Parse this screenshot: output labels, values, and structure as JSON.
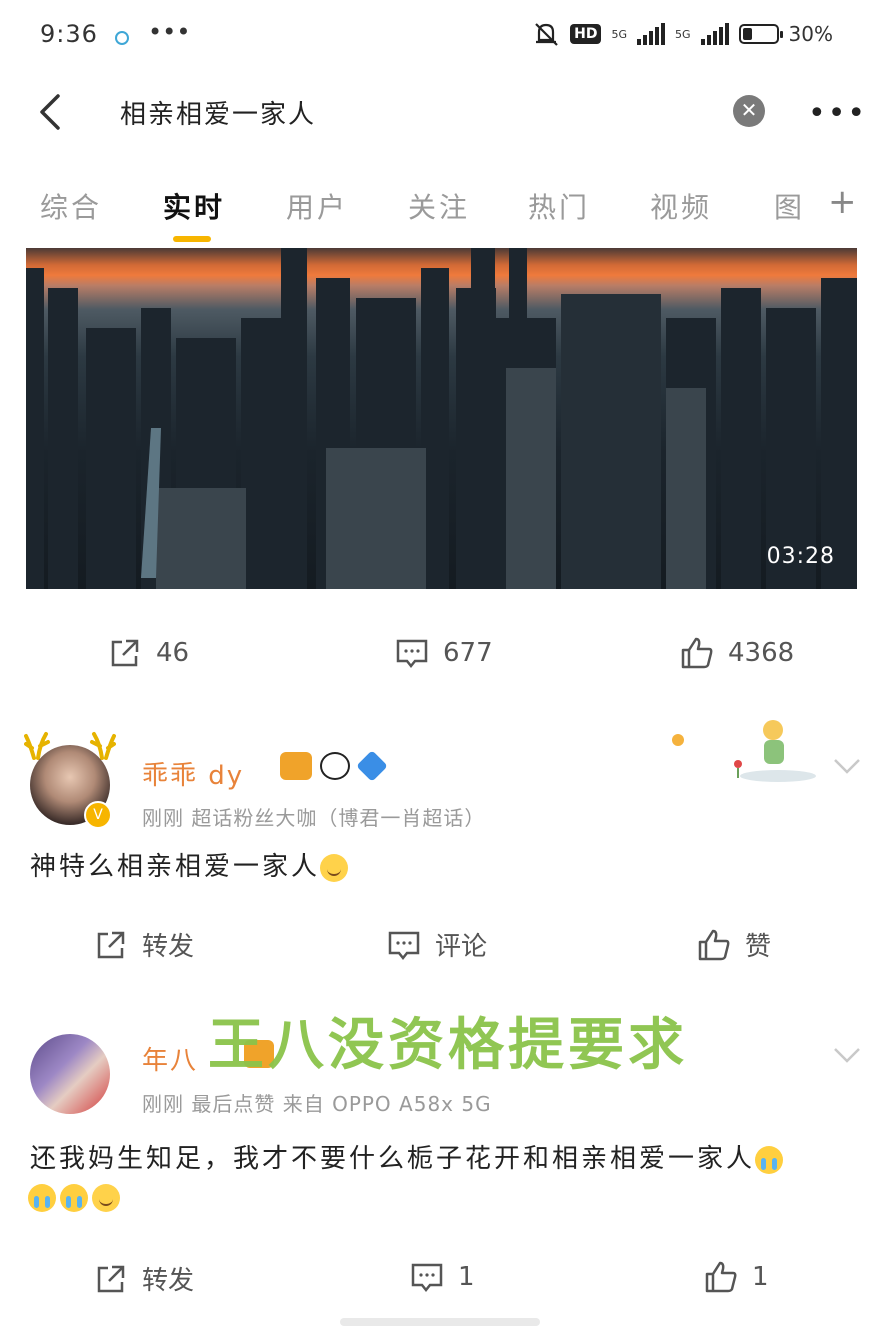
{
  "status_bar": {
    "time": "9:36",
    "dots": "•••",
    "hd_label": "HD",
    "net1": "5G",
    "net2": "5G",
    "battery": "30%",
    "battery_level": 0.3
  },
  "nav": {
    "search_query": "相亲相爱一家人",
    "clear_icon": "close-circle-icon",
    "more": "•••"
  },
  "tabs": [
    {
      "label": "综合"
    },
    {
      "label": "实时"
    },
    {
      "label": "用户"
    },
    {
      "label": "关注"
    },
    {
      "label": "热门"
    },
    {
      "label": "视频"
    },
    {
      "label": "图"
    }
  ],
  "tab_add": "+",
  "video": {
    "duration": "03:28"
  },
  "top_actions": {
    "share_count": "46",
    "comment_count": "677",
    "like_count": "4368"
  },
  "posts": [
    {
      "name": "乖乖     dy",
      "meta": "刚刚  超话粉丝大咖（博君一肖超话）",
      "text": "神特么相亲相爱一家人",
      "actions": {
        "share": "转发",
        "comment": "评论",
        "like": "赞"
      }
    },
    {
      "name": "年八",
      "meta": "刚刚  最后点赞  来自 OPPO A58x 5G",
      "text_line1": "还我妈生知足，我才不要什么栀子花开和相亲相爱一家人",
      "actions": {
        "share": "转发",
        "comment": "1",
        "like": "1"
      }
    }
  ],
  "watermark": "王八没资格提要求",
  "colors": {
    "accent": "#f7b500",
    "name_orange": "#e8833a",
    "watermark_green": "#8bc34a"
  }
}
